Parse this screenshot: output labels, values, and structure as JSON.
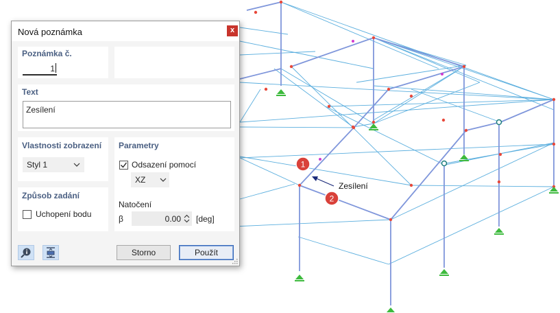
{
  "dialog": {
    "title": "Nová poznámka",
    "close_label": "x",
    "note_section": {
      "heading": "Poznámka č.",
      "number": "1"
    },
    "text_section": {
      "heading": "Text",
      "value": "Zesílení"
    },
    "display_section": {
      "heading": "Vlastnosti zobrazení",
      "style_value": "Styl 1"
    },
    "input_section": {
      "heading": "Způsob zadání",
      "snap_label": "Uchopení bodu",
      "snap_checked": false
    },
    "params_section": {
      "heading": "Parametry",
      "offset_label": "Odsazení pomocí",
      "offset_checked": true,
      "offset_plane": "XZ",
      "rotation_heading": "Natočení",
      "beta_symbol": "β",
      "beta_value": "0.00",
      "beta_unit": "[deg]"
    },
    "buttons": {
      "cancel": "Storno",
      "apply": "Použít"
    },
    "icons": [
      "info-search-icon",
      "workplane-icon"
    ]
  },
  "viewport": {
    "annotation_text": "Zesílení",
    "markers": [
      "1",
      "2"
    ],
    "colors": {
      "bracing": "#5aaede",
      "frame": "#7f96db",
      "node": "#e8483a",
      "support": "#3dba3d",
      "marker": "#d9413a"
    }
  }
}
